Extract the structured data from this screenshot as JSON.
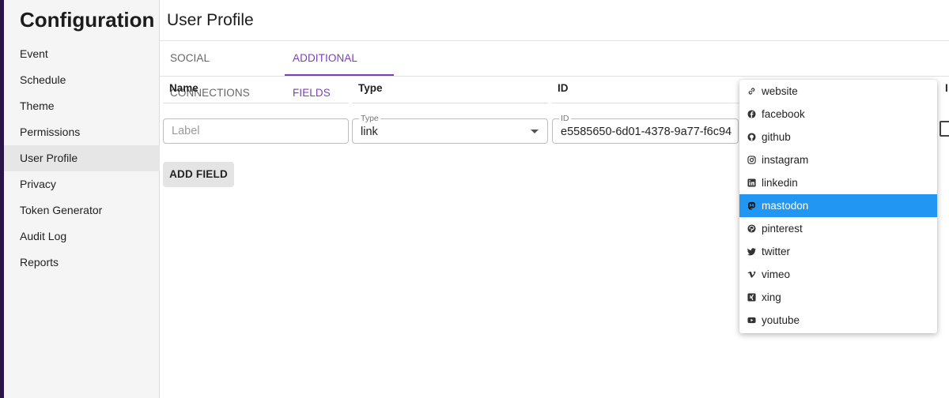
{
  "sidebar": {
    "title": "Configuration",
    "items": [
      {
        "label": "Event"
      },
      {
        "label": "Schedule"
      },
      {
        "label": "Theme"
      },
      {
        "label": "Permissions"
      },
      {
        "label": "User Profile",
        "active": true
      },
      {
        "label": "Privacy"
      },
      {
        "label": "Token Generator"
      },
      {
        "label": "Audit Log"
      },
      {
        "label": "Reports"
      }
    ]
  },
  "page": {
    "title": "User Profile",
    "tabs": [
      {
        "label": "SOCIAL CONNECTIONS"
      },
      {
        "label": "ADDITIONAL FIELDS",
        "active": true
      }
    ],
    "accent_color": "#7b3fb8"
  },
  "table": {
    "headers": [
      "Name",
      "Type",
      "ID"
    ],
    "row": {
      "name_placeholder": "Label",
      "type_legend": "Type",
      "type_value": "link",
      "id_legend": "ID",
      "id_value": "e5585650-6d01-4378-9a77-f6c94"
    },
    "add_button": "ADD FIELD"
  },
  "dropdown": {
    "selected_color": "#2196f3",
    "options": [
      {
        "label": "website",
        "icon": "link-icon"
      },
      {
        "label": "facebook",
        "icon": "facebook-icon"
      },
      {
        "label": "github",
        "icon": "github-icon"
      },
      {
        "label": "instagram",
        "icon": "instagram-icon"
      },
      {
        "label": "linkedin",
        "icon": "linkedin-icon"
      },
      {
        "label": "mastodon",
        "icon": "mastodon-icon",
        "selected": true
      },
      {
        "label": "pinterest",
        "icon": "pinterest-icon"
      },
      {
        "label": "twitter",
        "icon": "twitter-icon"
      },
      {
        "label": "vimeo",
        "icon": "vimeo-icon"
      },
      {
        "label": "xing",
        "icon": "xing-icon"
      },
      {
        "label": "youtube",
        "icon": "youtube-icon"
      }
    ]
  }
}
